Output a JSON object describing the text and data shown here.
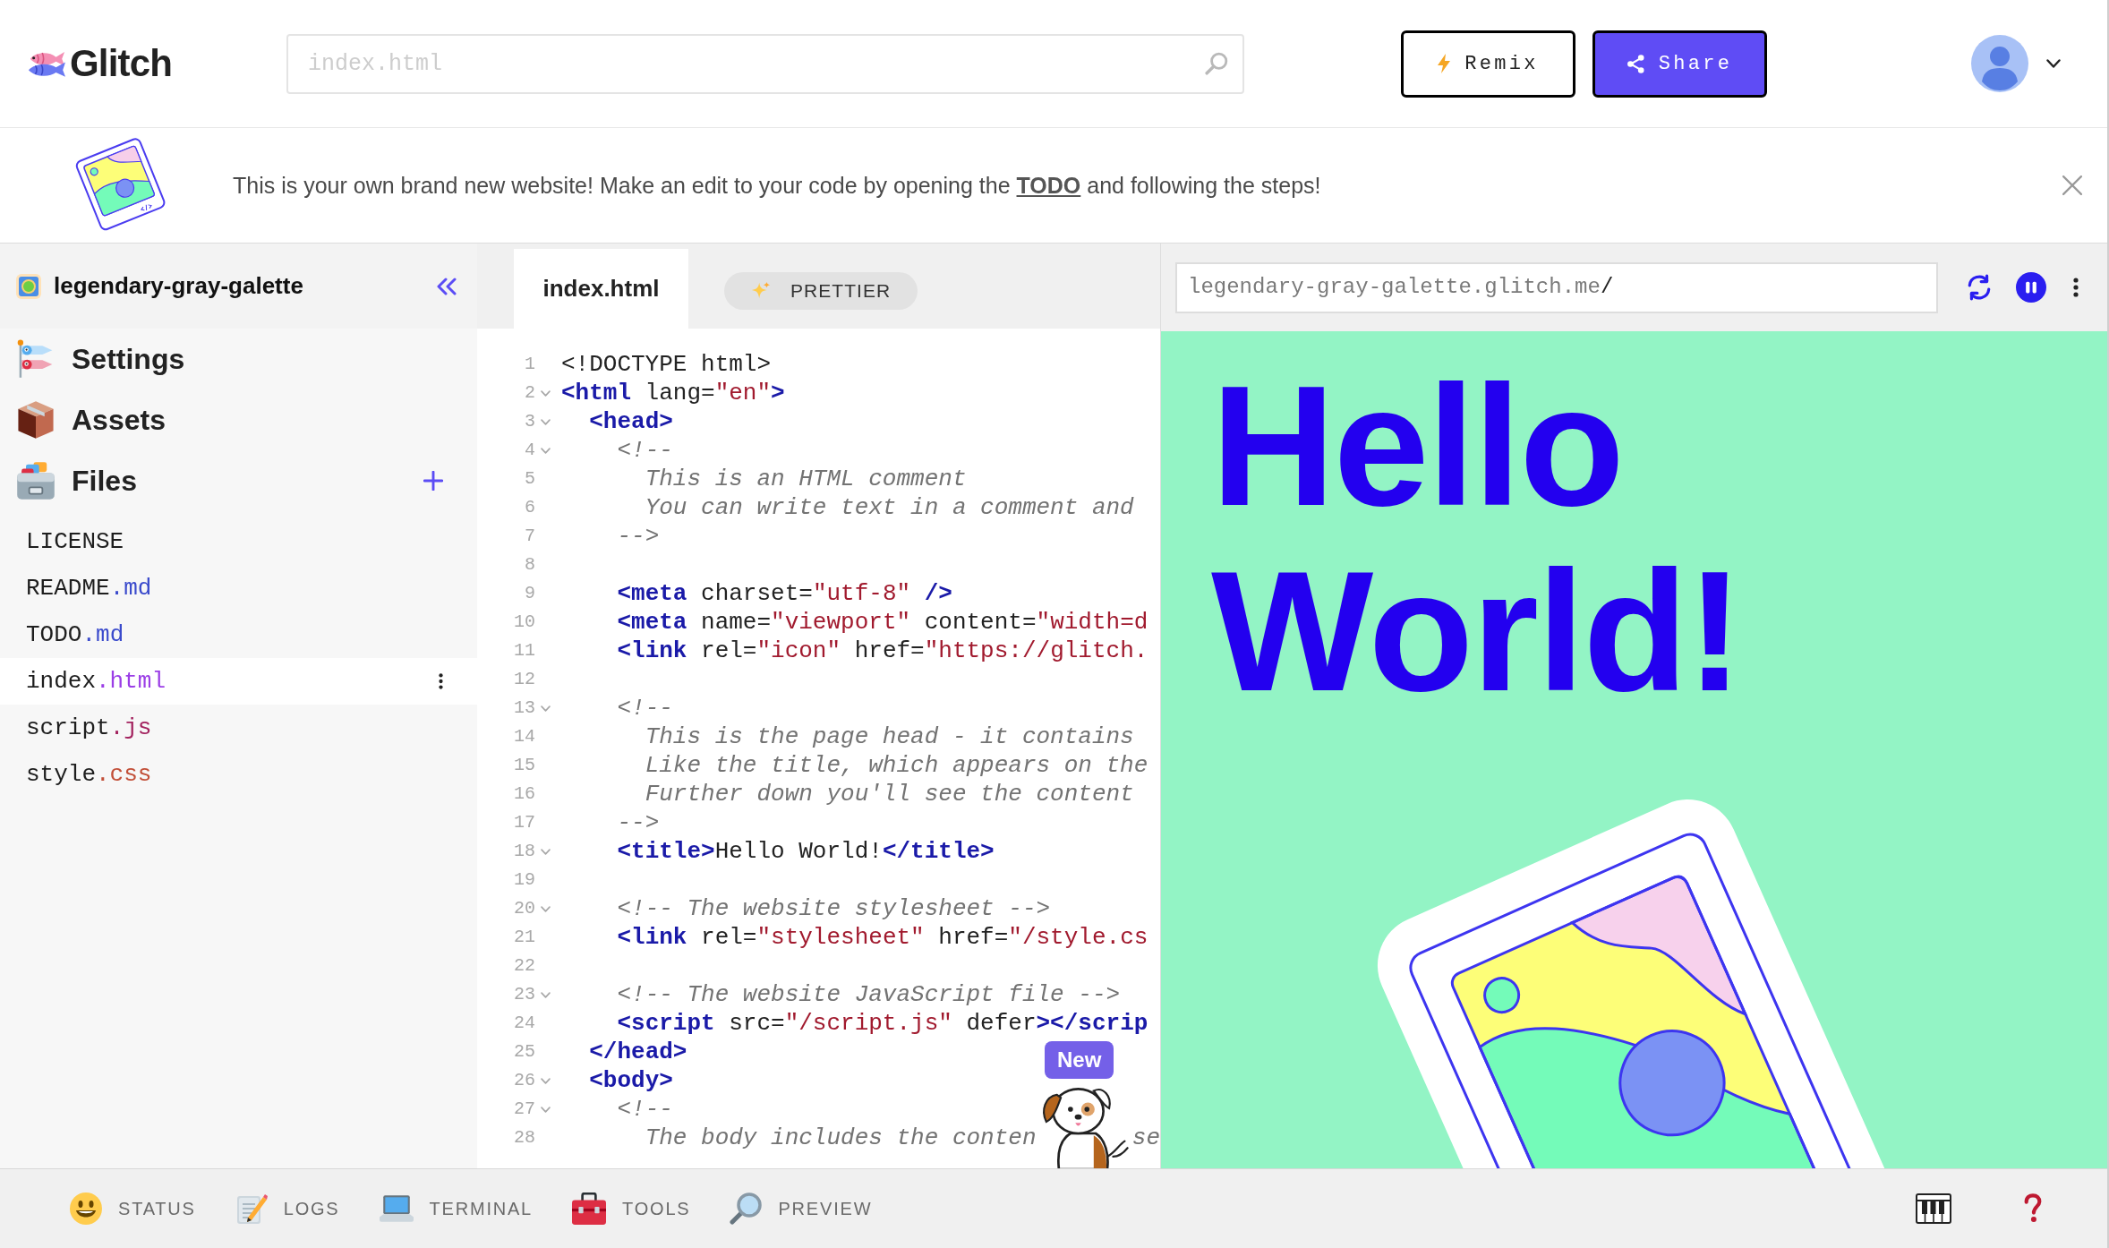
{
  "topbar": {
    "logo": "Glitch",
    "search": {
      "placeholder": "index.html"
    },
    "buttons": [
      {
        "kind": "remix",
        "label": "Remix"
      },
      {
        "kind": "share",
        "label": "Share"
      }
    ]
  },
  "banner": {
    "before": "This is your own brand new website! Make an edit to your code by opening the",
    "link": "TODO",
    "after": "and following the steps!"
  },
  "sidebar": {
    "project": "legendary-gray-galette",
    "sections": [
      {
        "kind": "settings",
        "label": "Settings"
      },
      {
        "kind": "assets",
        "label": "Assets"
      },
      {
        "kind": "files",
        "label": "Files"
      }
    ],
    "files": [
      {
        "name": "LICENSE",
        "selected": false
      },
      {
        "name": "README",
        "ext": ".md",
        "color": "#3b4bcc",
        "selected": false
      },
      {
        "name": "TODO",
        "ext": ".md",
        "color": "#3b4bcc",
        "selected": false
      },
      {
        "name": "index",
        "ext": ".html",
        "color": "#9b3ee6",
        "selected": true
      },
      {
        "name": "script",
        "ext": ".js",
        "color": "#a3235f",
        "selected": false
      },
      {
        "name": "style",
        "ext": ".css",
        "color": "#c24f38",
        "selected": false
      }
    ]
  },
  "editor": {
    "tabs": [
      {
        "label": "index.html",
        "selected": true
      }
    ],
    "prettier": "PRETTIER",
    "lines": [
      {
        "number": "1",
        "fold": false,
        "tokens": [
          {
            "kind": "plain",
            "text": "<!DOCTYPE html>"
          }
        ]
      },
      {
        "number": "2",
        "fold": true,
        "tokens": [
          {
            "kind": "tag",
            "text": "<html"
          },
          {
            "kind": "plain",
            "text": " lang="
          },
          {
            "kind": "string",
            "text": "\"en\""
          },
          {
            "kind": "tag",
            "text": ">"
          }
        ]
      },
      {
        "number": "3",
        "fold": true,
        "tokens": [
          {
            "kind": "tag",
            "text": "  <head>"
          }
        ]
      },
      {
        "number": "4",
        "fold": true,
        "tokens": [
          {
            "kind": "comment",
            "text": "    <!--"
          }
        ]
      },
      {
        "number": "5",
        "fold": false,
        "tokens": [
          {
            "kind": "comment",
            "text": "      This is an HTML comment"
          }
        ]
      },
      {
        "number": "6",
        "fold": false,
        "tokens": [
          {
            "kind": "comment",
            "text": "      You can write text in a comment and"
          }
        ]
      },
      {
        "number": "7",
        "fold": false,
        "tokens": [
          {
            "kind": "comment",
            "text": "    -->"
          }
        ]
      },
      {
        "number": "8",
        "fold": false
      },
      {
        "number": "9",
        "fold": false,
        "tokens": [
          {
            "kind": "tag",
            "text": "    <meta"
          },
          {
            "kind": "plain",
            "text": " charset="
          },
          {
            "kind": "string",
            "text": "\"utf-8\""
          },
          {
            "kind": "tag",
            "text": " />"
          }
        ]
      },
      {
        "number": "10",
        "fold": false,
        "tokens": [
          {
            "kind": "tag",
            "text": "    <meta"
          },
          {
            "kind": "plain",
            "text": " name="
          },
          {
            "kind": "string",
            "text": "\"viewport\""
          },
          {
            "kind": "plain",
            "text": " content="
          },
          {
            "kind": "string",
            "text": "\"width=d"
          }
        ]
      },
      {
        "number": "11",
        "fold": false,
        "tokens": [
          {
            "kind": "tag",
            "text": "    <link"
          },
          {
            "kind": "plain",
            "text": " rel="
          },
          {
            "kind": "string",
            "text": "\"icon\""
          },
          {
            "kind": "plain",
            "text": " href="
          },
          {
            "kind": "string",
            "text": "\"https://glitch."
          }
        ]
      },
      {
        "number": "12",
        "fold": false
      },
      {
        "number": "13",
        "fold": true,
        "tokens": [
          {
            "kind": "comment",
            "text": "    <!--"
          }
        ]
      },
      {
        "number": "14",
        "fold": false,
        "tokens": [
          {
            "kind": "comment",
            "text": "      This is the page head - it contains"
          }
        ]
      },
      {
        "number": "15",
        "fold": false,
        "tokens": [
          {
            "kind": "comment",
            "text": "      Like the title, which appears on the"
          }
        ]
      },
      {
        "number": "16",
        "fold": false,
        "tokens": [
          {
            "kind": "comment",
            "text": "      Further down you'll see the content"
          }
        ]
      },
      {
        "number": "17",
        "fold": false,
        "tokens": [
          {
            "kind": "comment",
            "text": "    -->"
          }
        ]
      },
      {
        "number": "18",
        "fold": true,
        "tokens": [
          {
            "kind": "tag",
            "text": "    <title>"
          },
          {
            "kind": "plain",
            "text": "Hello World!"
          },
          {
            "kind": "tag",
            "text": "</title>"
          }
        ]
      },
      {
        "number": "19",
        "fold": false
      },
      {
        "number": "20",
        "fold": true,
        "tokens": [
          {
            "kind": "comment",
            "text": "    <!-- The website stylesheet -->"
          }
        ]
      },
      {
        "number": "21",
        "fold": false,
        "tokens": [
          {
            "kind": "tag",
            "text": "    <link"
          },
          {
            "kind": "plain",
            "text": " rel="
          },
          {
            "kind": "string",
            "text": "\"stylesheet\""
          },
          {
            "kind": "plain",
            "text": " href="
          },
          {
            "kind": "string",
            "text": "\"/style.cs"
          }
        ]
      },
      {
        "number": "22",
        "fold": false
      },
      {
        "number": "23",
        "fold": true,
        "tokens": [
          {
            "kind": "comment",
            "text": "    <!-- The website JavaScript file -->"
          }
        ]
      },
      {
        "number": "24",
        "fold": false,
        "tokens": [
          {
            "kind": "tag",
            "text": "    <script"
          },
          {
            "kind": "plain",
            "text": " src="
          },
          {
            "kind": "string",
            "text": "\"/script.js\""
          },
          {
            "kind": "plain",
            "text": " defer"
          },
          {
            "kind": "tag",
            "text": "></scrip"
          }
        ]
      },
      {
        "number": "25",
        "fold": false,
        "tokens": [
          {
            "kind": "tag",
            "text": "  </head>"
          }
        ]
      },
      {
        "number": "26",
        "fold": true,
        "tokens": [
          {
            "kind": "tag",
            "text": "  <body>"
          }
        ]
      },
      {
        "number": "27",
        "fold": true,
        "tokens": [
          {
            "kind": "comment",
            "text": "    <!--"
          }
        ]
      },
      {
        "number": "28",
        "fold": false,
        "tokens": [
          {
            "kind": "comment",
            "text": "      The body includes the conten"
          },
          {
            "kind": "covered"
          },
          {
            "kind": "comment",
            "text": "se"
          }
        ]
      }
    ],
    "mascot": {
      "badge": "New"
    }
  },
  "preview": {
    "url": {
      "host": "legendary-gray-galette.glitch.me",
      "path": "/"
    },
    "heading": "Hello World!"
  },
  "bottom_bar": {
    "items": [
      {
        "kind": "status",
        "label": "STATUS"
      },
      {
        "kind": "logs",
        "label": "LOGS"
      },
      {
        "kind": "terminal",
        "label": "TERMINAL"
      },
      {
        "kind": "tools",
        "label": "TOOLS"
      },
      {
        "kind": "preview",
        "label": "PREVIEW"
      }
    ]
  }
}
